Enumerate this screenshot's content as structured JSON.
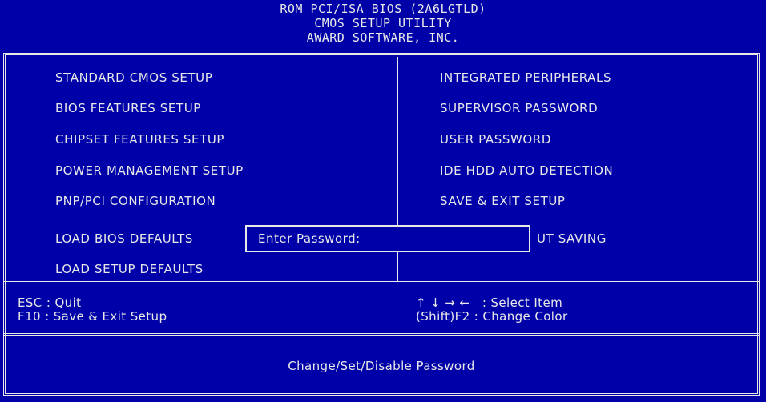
{
  "header": {
    "line1": "ROM PCI/ISA BIOS (2A6LGTLD)",
    "line2": "CMOS SETUP UTILITY",
    "line3": "AWARD SOFTWARE, INC."
  },
  "menu": {
    "left": [
      "STANDARD CMOS SETUP",
      "BIOS FEATURES SETUP",
      "CHIPSET FEATURES SETUP",
      "POWER MANAGEMENT SETUP",
      "PNP/PCI CONFIGURATION",
      "LOAD BIOS DEFAULTS",
      "LOAD SETUP DEFAULTS"
    ],
    "right": [
      "INTEGRATED PERIPHERALS",
      "SUPERVISOR PASSWORD",
      "USER PASSWORD",
      "IDE HDD AUTO DETECTION",
      "SAVE & EXIT SETUP",
      "UT SAVING"
    ]
  },
  "dialog": {
    "label": "Enter Password:",
    "value": ""
  },
  "help": {
    "esc": "ESC : Quit",
    "f10": "F10 : Save & Exit Setup",
    "select": "↑ ↓ → ←   : Select Item",
    "color": "(Shift)F2 : Change Color"
  },
  "status": "Change/Set/Disable Password",
  "colors": {
    "background": "#0000a8",
    "text": "#e8e8e8"
  }
}
